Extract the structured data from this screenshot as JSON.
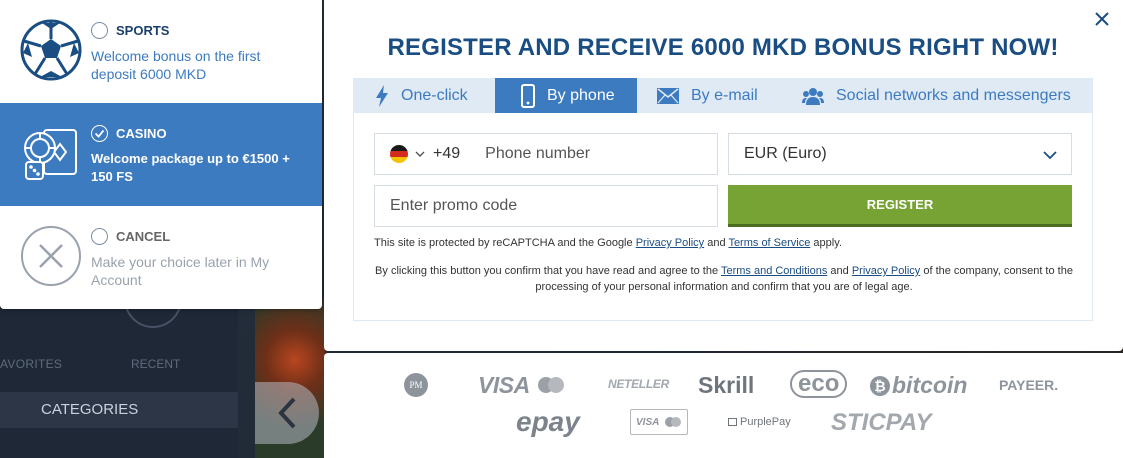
{
  "background": {
    "favorites_label": "AVORITES",
    "recent_label": "RECENT",
    "categories_label": "CATEGORIES"
  },
  "bonus_choices": [
    {
      "title": "SPORTS",
      "description": "Welcome bonus on the first deposit 6000 MKD",
      "icon": "soccer-ball-icon",
      "selected": false
    },
    {
      "title": "CASINO",
      "description": "Welcome package up to €1500 + 150 FS",
      "icon": "casino-chips-cards-icon",
      "selected": true
    },
    {
      "title": "CANCEL",
      "description": "Make your choice later in My Account",
      "icon": "cancel-x-icon",
      "selected": false
    }
  ],
  "modal": {
    "title": "REGISTER AND RECEIVE 6000 MKD BONUS RIGHT NOW!",
    "tabs": [
      {
        "label": "One-click",
        "icon": "lightning-icon",
        "active": false
      },
      {
        "label": "By phone",
        "icon": "phone-icon",
        "active": true
      },
      {
        "label": "By e-mail",
        "icon": "envelope-icon",
        "active": false
      },
      {
        "label": "Social networks and messengers",
        "icon": "users-icon",
        "active": false
      }
    ],
    "phone": {
      "country_code": "+49",
      "placeholder": "Phone number",
      "flag": "germany-flag-icon"
    },
    "currency": {
      "value": "EUR (Euro)"
    },
    "promo": {
      "placeholder": "Enter promo code"
    },
    "register_label": "REGISTER",
    "captcha": {
      "pre": "This site is protected by reCAPTCHA and the Google ",
      "privacy": "Privacy Policy",
      "and": " and ",
      "terms": "Terms of Service",
      "post": " apply."
    },
    "agreement": {
      "pre": "By clicking this button you confirm that you have read and agree to the ",
      "terms": "Terms and Conditions",
      "and": " and ",
      "privacy": "Privacy Policy",
      "post": " of the company, consent to the processing of your personal information and confirm that you are of legal age."
    }
  },
  "payment_logos": {
    "pm": "PM",
    "visa": "VISA",
    "neteller": "NETELLER",
    "skrill": "Skrill",
    "eco": "eco",
    "bitcoin": "bitcoin",
    "payeer": "PAYEER.",
    "epay": "epay",
    "visa_small": "VISA",
    "purplepay": "PurplePay",
    "sticpay": "STICPAY"
  },
  "colors": {
    "brand_blue": "#3d7bc0",
    "title_blue": "#1a4d82",
    "register_green": "#76a333",
    "tab_bg": "#dfeaf5"
  }
}
